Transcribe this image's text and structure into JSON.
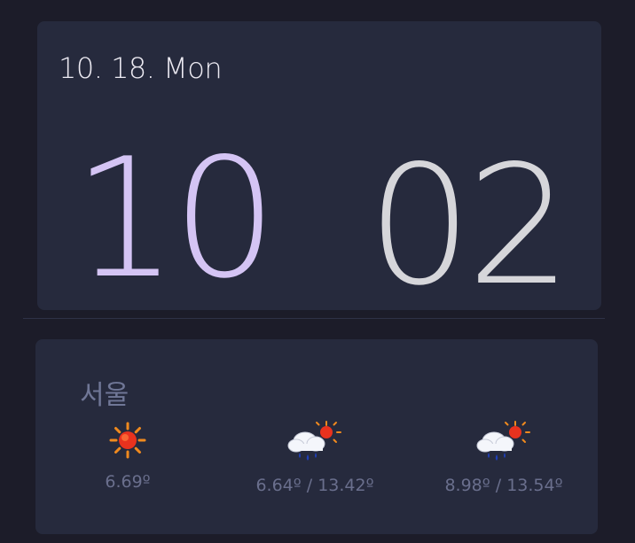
{
  "clock": {
    "date": "10. 18. Mon",
    "hours": "10",
    "minutes": "02"
  },
  "weather": {
    "city": "서울",
    "forecast": [
      {
        "icon": "sun-icon",
        "temp": "6.69º"
      },
      {
        "icon": "rain-cloud-sun-icon",
        "temp": "6.64º / 13.42º"
      },
      {
        "icon": "rain-cloud-sun-icon",
        "temp": "8.98º / 13.54º"
      }
    ]
  },
  "colors": {
    "background": "#1c1c29",
    "card": "#262a3d",
    "hours": "#d4c4f4",
    "minutes": "#d6d6da"
  }
}
